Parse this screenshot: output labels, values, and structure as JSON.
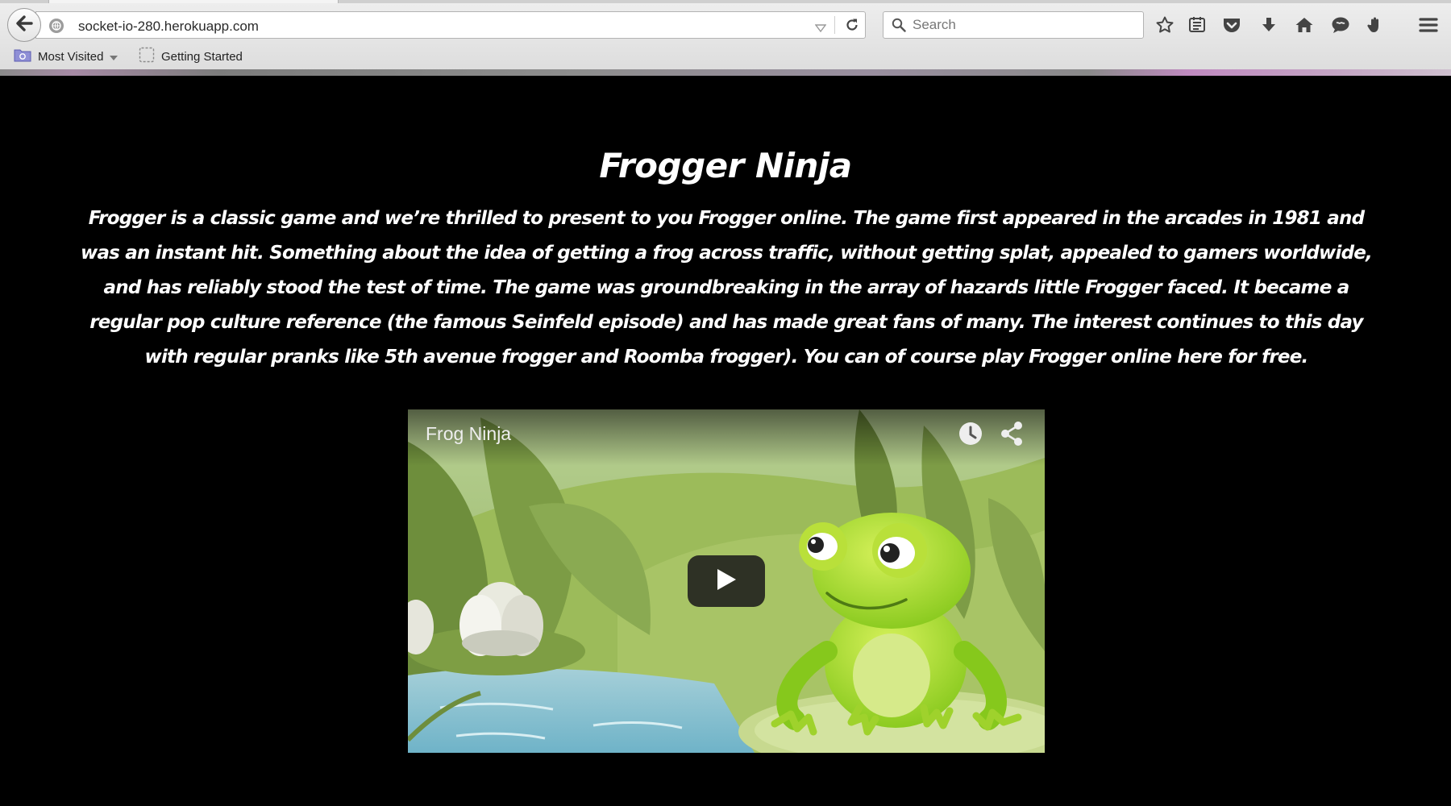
{
  "browser": {
    "url": "socket-io-280.herokuapp.com",
    "search_placeholder": "Search",
    "icons": {
      "back": "back-arrow-icon",
      "site_identity": "globe-icon",
      "history_dropdown": "triangle-down-icon",
      "reload": "reload-icon",
      "search": "search-icon",
      "bookmark": "star-icon",
      "reading_list": "reading-list-icon",
      "pocket": "pocket-icon",
      "downloads": "download-icon",
      "home": "home-icon",
      "chat": "chat-icon",
      "extension": "hand-icon",
      "menu": "hamburger-menu-icon"
    },
    "bookmarks": [
      {
        "label": "Most Visited",
        "icon": "folder-icon",
        "has_dropdown": true
      },
      {
        "label": "Getting Started",
        "icon": "page-icon"
      }
    ]
  },
  "page": {
    "title": "Frogger Ninja",
    "intro": "Frogger is a classic game and we’re thrilled to present to you Frogger online. The game first appeared in the arcades in 1981 and was an instant hit. Something about the idea of getting a frog across traffic, without getting splat, appealed to gamers worldwide, and has reliably stood the test of time. The game was groundbreaking in the array of hazards little Frogger faced. It became a regular pop culture reference (the famous Seinfeld episode) and has made great fans of many. The interest continues to this day with regular pranks like 5th avenue frogger and Roomba frogger). You can of course play Frogger online here for free.",
    "background_color": "#000000",
    "text_color": "#ffffff"
  },
  "video": {
    "title": "Frog Ninja",
    "icons": {
      "watch_later": "clock-icon",
      "share": "share-icon",
      "play": "play-icon"
    }
  }
}
